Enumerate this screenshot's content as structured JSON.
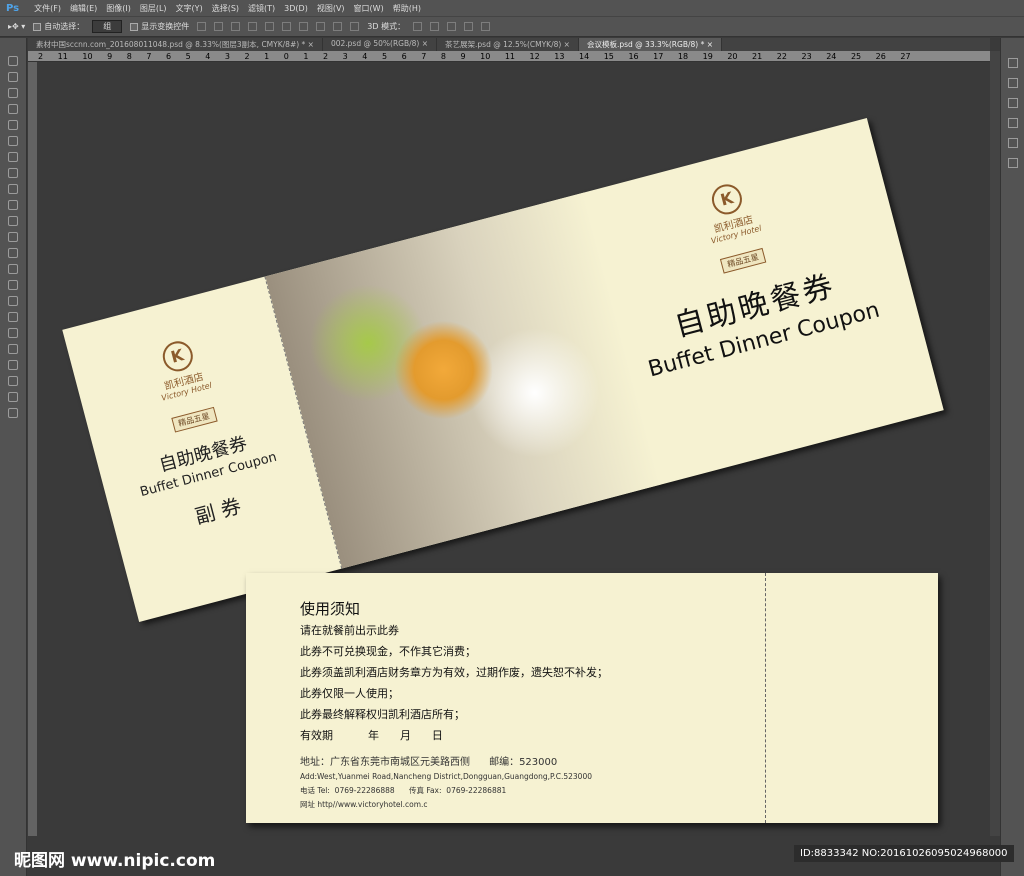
{
  "app": {
    "logo": "Ps"
  },
  "menu": [
    "文件(F)",
    "编辑(E)",
    "图像(I)",
    "图层(L)",
    "文字(Y)",
    "选择(S)",
    "滤镜(T)",
    "3D(D)",
    "视图(V)",
    "窗口(W)",
    "帮助(H)"
  ],
  "options": {
    "auto_select": "自动选择：",
    "auto_select_value": "组",
    "show_transform": "显示变换控件",
    "mode_3d": "3D 模式："
  },
  "tabs": [
    {
      "label": "素材中国sccnn.com_201608011048.psd @ 8.33%(图层3副本, CMYK/8#) *"
    },
    {
      "label": "002.psd @ 50%(RGB/8)"
    },
    {
      "label": "茶艺展架.psd @ 12.5%(CMYK/8)"
    },
    {
      "label": "会议模板.psd @ 33.3%(RGB/8) *",
      "active": true
    }
  ],
  "ruler": "2 11 10 9 8 7 6 5 4 3 2 1 0 1 2 3 4 5 6 7 8 9 10 11 12 13 14 15 16 17 18 19 20 21 22 23 24 25 26 27",
  "coupon": {
    "logo_initial": "K",
    "logo_cn": "凯利酒店",
    "logo_en": "Victory Hotel",
    "badge": "精品五星",
    "title_cn": "自助晚餐券",
    "title_en": "Buffet Dinner Coupon",
    "stub_label": "副  券"
  },
  "back": {
    "heading": "使用须知",
    "rules": [
      "请在就餐前出示此券",
      "此券不可兑换现金，不作其它消费；",
      "此券须盖凯利酒店财务章方为有效，过期作废，遗失恕不补发；",
      "此券仅限一人使用；",
      "此券最终解释权归凯利酒店所有；"
    ],
    "validity": "有效期          年      月      日",
    "address": "地址：广东省东莞市南城区元美路西侧      邮编：523000",
    "address_en": "Add:West,Yuanmei Road,Nancheng District,Dongguan,Guangdong,P.C.523000",
    "phone": "电话 Tel:  0769-22286888      传真 Fax:  0769-22286881",
    "web": "网址 http//www.victoryhotel.com.c"
  },
  "watermark": "昵图网 www.nipic.com",
  "image_id": "ID:8833342 NO:20161026095024968000"
}
